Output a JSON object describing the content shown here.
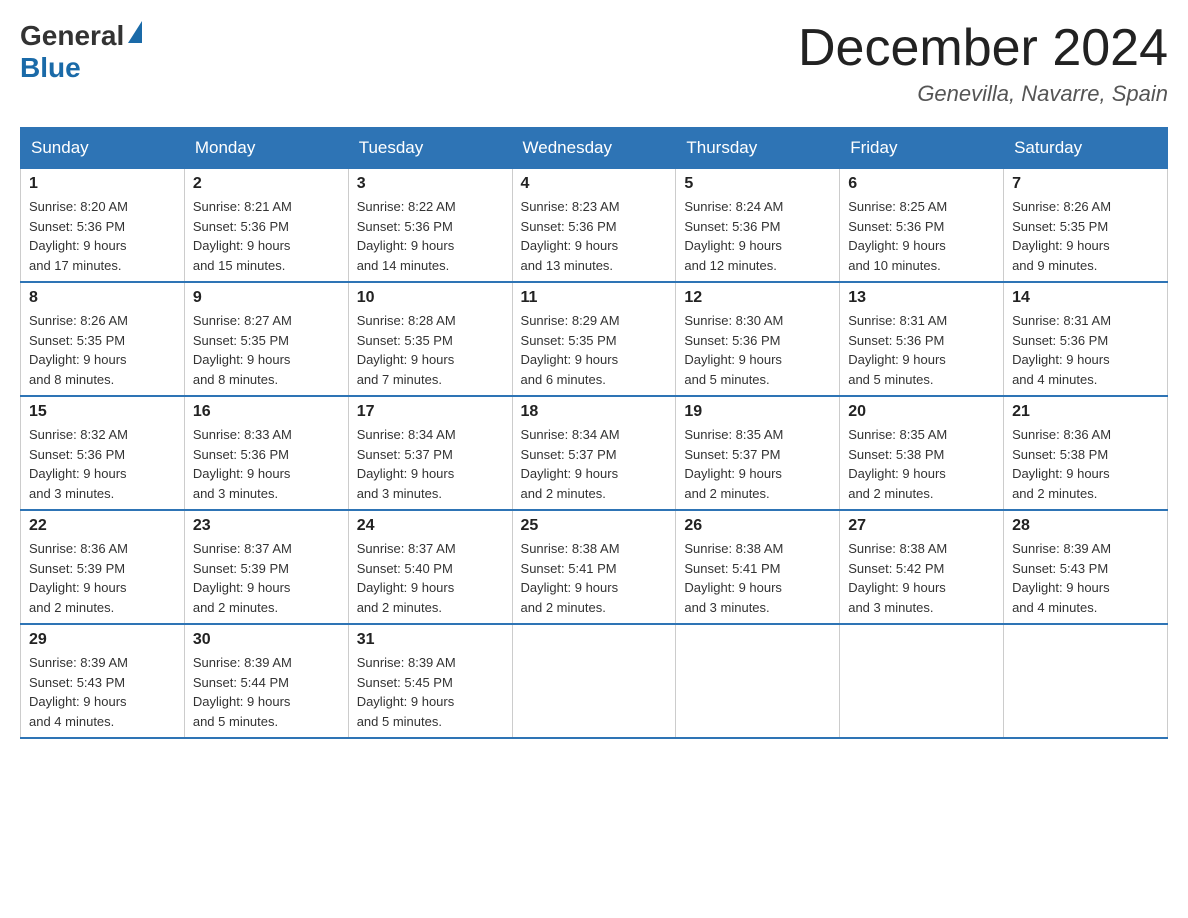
{
  "header": {
    "logo_general": "General",
    "logo_blue": "Blue",
    "month_title": "December 2024",
    "location": "Genevilla, Navarre, Spain"
  },
  "days_of_week": [
    "Sunday",
    "Monday",
    "Tuesday",
    "Wednesday",
    "Thursday",
    "Friday",
    "Saturday"
  ],
  "weeks": [
    [
      {
        "day": "1",
        "sunrise": "8:20 AM",
        "sunset": "5:36 PM",
        "daylight": "9 hours and 17 minutes."
      },
      {
        "day": "2",
        "sunrise": "8:21 AM",
        "sunset": "5:36 PM",
        "daylight": "9 hours and 15 minutes."
      },
      {
        "day": "3",
        "sunrise": "8:22 AM",
        "sunset": "5:36 PM",
        "daylight": "9 hours and 14 minutes."
      },
      {
        "day": "4",
        "sunrise": "8:23 AM",
        "sunset": "5:36 PM",
        "daylight": "9 hours and 13 minutes."
      },
      {
        "day": "5",
        "sunrise": "8:24 AM",
        "sunset": "5:36 PM",
        "daylight": "9 hours and 12 minutes."
      },
      {
        "day": "6",
        "sunrise": "8:25 AM",
        "sunset": "5:36 PM",
        "daylight": "9 hours and 10 minutes."
      },
      {
        "day": "7",
        "sunrise": "8:26 AM",
        "sunset": "5:35 PM",
        "daylight": "9 hours and 9 minutes."
      }
    ],
    [
      {
        "day": "8",
        "sunrise": "8:26 AM",
        "sunset": "5:35 PM",
        "daylight": "9 hours and 8 minutes."
      },
      {
        "day": "9",
        "sunrise": "8:27 AM",
        "sunset": "5:35 PM",
        "daylight": "9 hours and 8 minutes."
      },
      {
        "day": "10",
        "sunrise": "8:28 AM",
        "sunset": "5:35 PM",
        "daylight": "9 hours and 7 minutes."
      },
      {
        "day": "11",
        "sunrise": "8:29 AM",
        "sunset": "5:35 PM",
        "daylight": "9 hours and 6 minutes."
      },
      {
        "day": "12",
        "sunrise": "8:30 AM",
        "sunset": "5:36 PM",
        "daylight": "9 hours and 5 minutes."
      },
      {
        "day": "13",
        "sunrise": "8:31 AM",
        "sunset": "5:36 PM",
        "daylight": "9 hours and 5 minutes."
      },
      {
        "day": "14",
        "sunrise": "8:31 AM",
        "sunset": "5:36 PM",
        "daylight": "9 hours and 4 minutes."
      }
    ],
    [
      {
        "day": "15",
        "sunrise": "8:32 AM",
        "sunset": "5:36 PM",
        "daylight": "9 hours and 3 minutes."
      },
      {
        "day": "16",
        "sunrise": "8:33 AM",
        "sunset": "5:36 PM",
        "daylight": "9 hours and 3 minutes."
      },
      {
        "day": "17",
        "sunrise": "8:34 AM",
        "sunset": "5:37 PM",
        "daylight": "9 hours and 3 minutes."
      },
      {
        "day": "18",
        "sunrise": "8:34 AM",
        "sunset": "5:37 PM",
        "daylight": "9 hours and 2 minutes."
      },
      {
        "day": "19",
        "sunrise": "8:35 AM",
        "sunset": "5:37 PM",
        "daylight": "9 hours and 2 minutes."
      },
      {
        "day": "20",
        "sunrise": "8:35 AM",
        "sunset": "5:38 PM",
        "daylight": "9 hours and 2 minutes."
      },
      {
        "day": "21",
        "sunrise": "8:36 AM",
        "sunset": "5:38 PM",
        "daylight": "9 hours and 2 minutes."
      }
    ],
    [
      {
        "day": "22",
        "sunrise": "8:36 AM",
        "sunset": "5:39 PM",
        "daylight": "9 hours and 2 minutes."
      },
      {
        "day": "23",
        "sunrise": "8:37 AM",
        "sunset": "5:39 PM",
        "daylight": "9 hours and 2 minutes."
      },
      {
        "day": "24",
        "sunrise": "8:37 AM",
        "sunset": "5:40 PM",
        "daylight": "9 hours and 2 minutes."
      },
      {
        "day": "25",
        "sunrise": "8:38 AM",
        "sunset": "5:41 PM",
        "daylight": "9 hours and 2 minutes."
      },
      {
        "day": "26",
        "sunrise": "8:38 AM",
        "sunset": "5:41 PM",
        "daylight": "9 hours and 3 minutes."
      },
      {
        "day": "27",
        "sunrise": "8:38 AM",
        "sunset": "5:42 PM",
        "daylight": "9 hours and 3 minutes."
      },
      {
        "day": "28",
        "sunrise": "8:39 AM",
        "sunset": "5:43 PM",
        "daylight": "9 hours and 4 minutes."
      }
    ],
    [
      {
        "day": "29",
        "sunrise": "8:39 AM",
        "sunset": "5:43 PM",
        "daylight": "9 hours and 4 minutes."
      },
      {
        "day": "30",
        "sunrise": "8:39 AM",
        "sunset": "5:44 PM",
        "daylight": "9 hours and 5 minutes."
      },
      {
        "day": "31",
        "sunrise": "8:39 AM",
        "sunset": "5:45 PM",
        "daylight": "9 hours and 5 minutes."
      },
      null,
      null,
      null,
      null
    ]
  ],
  "labels": {
    "sunrise": "Sunrise:",
    "sunset": "Sunset:",
    "daylight": "Daylight:"
  }
}
